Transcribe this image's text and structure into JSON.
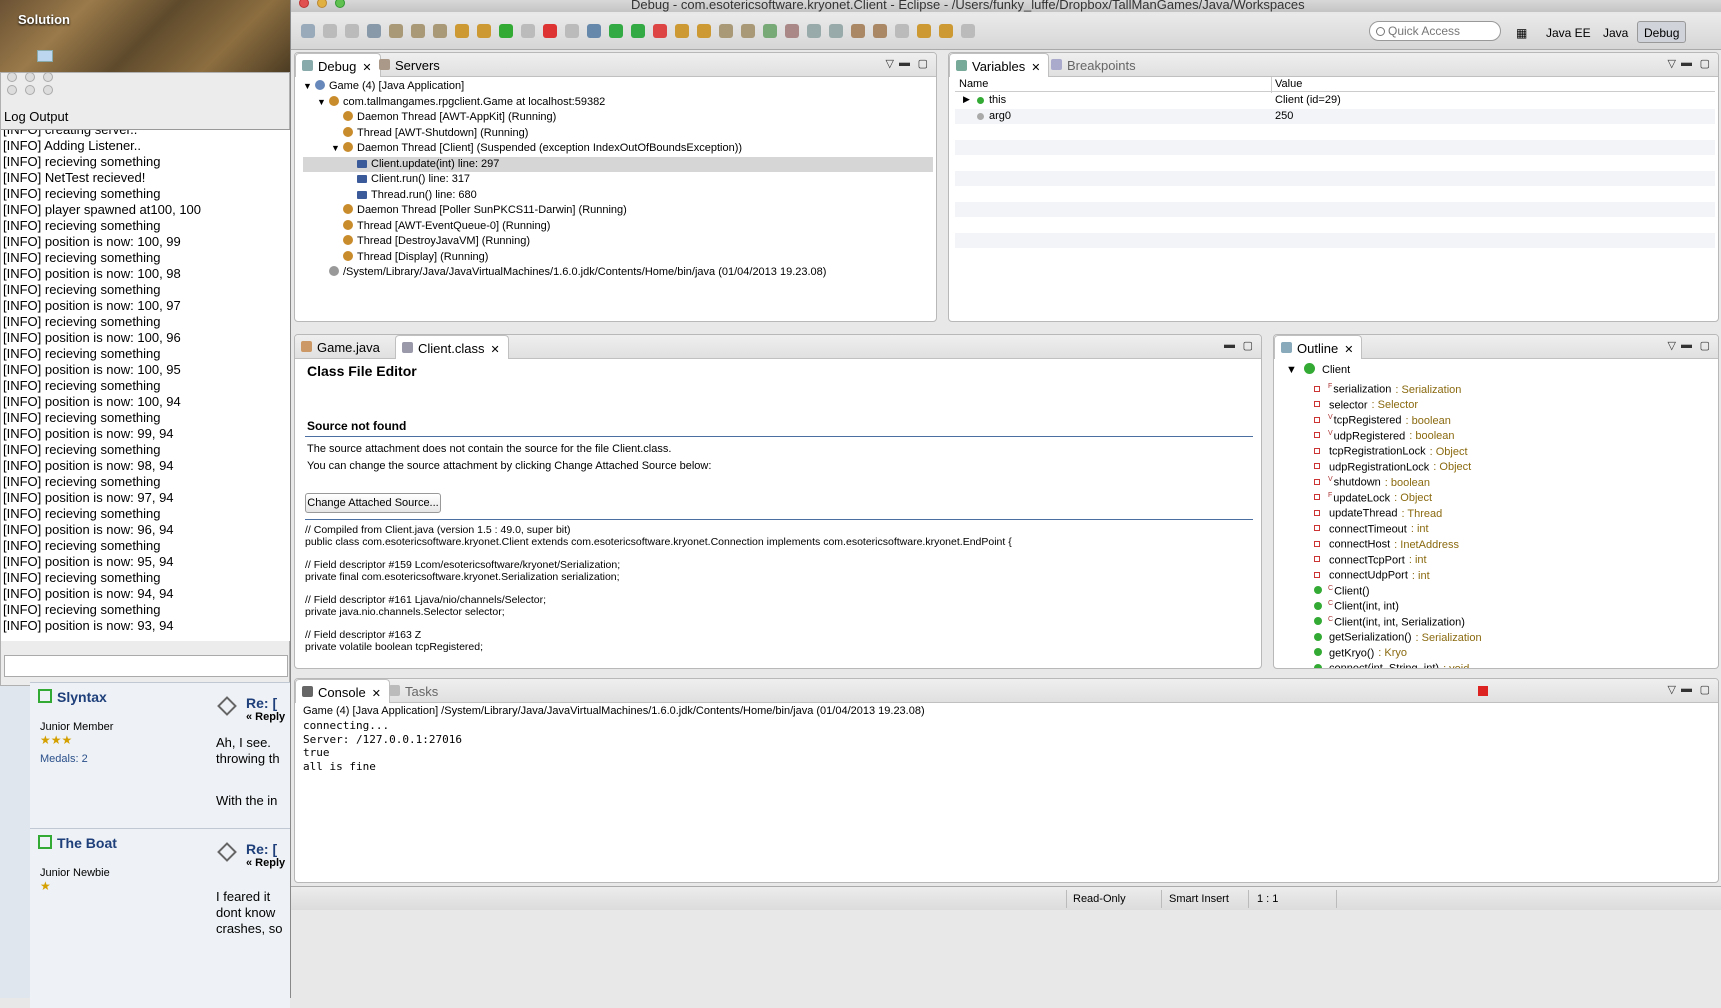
{
  "desktop": {
    "folder_label": "Solution"
  },
  "log_window": {
    "title": "Log Output",
    "lines": [
      "[INFO] creating server..",
      "[INFO] Adding Listener..",
      "[INFO] recieving something",
      "[INFO] NetTest recieved!",
      "[INFO] recieving something",
      "[INFO] player spawned at100, 100",
      "[INFO] recieving something",
      "[INFO] position is now: 100, 99",
      "[INFO] recieving something",
      "[INFO] position is now: 100, 98",
      "[INFO] recieving something",
      "[INFO] position is now: 100, 97",
      "[INFO] recieving something",
      "[INFO] position is now: 100, 96",
      "[INFO] recieving something",
      "[INFO] position is now: 100, 95",
      "[INFO] recieving something",
      "[INFO] position is now: 100, 94",
      "[INFO] recieving something",
      "[INFO] position is now: 99, 94",
      "[INFO] recieving something",
      "[INFO] position is now: 98, 94",
      "[INFO] recieving something",
      "[INFO] position is now: 97, 94",
      "[INFO] recieving something",
      "[INFO] position is now: 96, 94",
      "[INFO] recieving something",
      "[INFO] position is now: 95, 94",
      "[INFO] recieving something",
      "[INFO] position is now: 94, 94",
      "[INFO] recieving something",
      "[INFO] position is now: 93, 94"
    ]
  },
  "forum": {
    "posts": [
      {
        "author": "Slyntax",
        "rank": "Junior Member",
        "stars": "★★★",
        "medals": "Medals: 2",
        "re": "Re: [",
        "reply": "« Reply",
        "text": [
          "Ah, I see.",
          "throwing th",
          "",
          "With the in"
        ]
      },
      {
        "author": "The Boat",
        "rank": "Junior Newbie",
        "stars": "★",
        "medals": "",
        "re": "Re: [",
        "reply": "« Reply",
        "text": [
          "I feared it",
          "dont know",
          "crashes, so"
        ]
      }
    ]
  },
  "eclipse": {
    "title": "Debug - com.esotericsoftware.kryonet.Client - Eclipse - /Users/funky_luffe/Dropbox/TallManGames/Java/Workspaces",
    "quick_access_placeholder": "Quick Access",
    "perspectives": [
      "Java EE",
      "Java",
      "Debug"
    ],
    "debug_panel": {
      "tabs": [
        "Debug",
        "Servers"
      ],
      "tree": [
        {
          "text": "Game (4) [Java Application]",
          "level": 0,
          "icon": "java-app-icon",
          "exp": "▼"
        },
        {
          "text": "com.tallmangames.rpgclient.Game at localhost:59382",
          "level": 1,
          "icon": "process-icon",
          "exp": "▼"
        },
        {
          "text": "Daemon Thread [AWT-AppKit] (Running)",
          "level": 2,
          "icon": "thread-running-icon",
          "exp": ""
        },
        {
          "text": "Thread [AWT-Shutdown] (Running)",
          "level": 2,
          "icon": "thread-running-icon",
          "exp": ""
        },
        {
          "text": "Daemon Thread [Client] (Suspended (exception IndexOutOfBoundsException))",
          "level": 2,
          "icon": "thread-suspended-icon",
          "exp": "▼"
        },
        {
          "text": "Client.update(int) line: 297",
          "level": 3,
          "icon": "stack-frame-icon",
          "exp": ""
        },
        {
          "text": "Client.run() line: 317",
          "level": 3,
          "icon": "stack-frame-icon",
          "exp": ""
        },
        {
          "text": "Thread.run() line: 680",
          "level": 3,
          "icon": "stack-frame-icon",
          "exp": ""
        },
        {
          "text": "Daemon Thread [Poller SunPKCS11-Darwin] (Running)",
          "level": 2,
          "icon": "thread-running-icon",
          "exp": ""
        },
        {
          "text": "Thread [AWT-EventQueue-0] (Running)",
          "level": 2,
          "icon": "thread-running-icon",
          "exp": ""
        },
        {
          "text": "Thread [DestroyJavaVM] (Running)",
          "level": 2,
          "icon": "thread-running-icon",
          "exp": ""
        },
        {
          "text": "Thread [Display] (Running)",
          "level": 2,
          "icon": "thread-running-icon",
          "exp": ""
        },
        {
          "text": "/System/Library/Java/JavaVirtualMachines/1.6.0.jdk/Contents/Home/bin/java (01/04/2013 19.23.08)",
          "level": 1,
          "icon": "vm-icon",
          "exp": ""
        }
      ]
    },
    "variables_panel": {
      "tabs": [
        "Variables",
        "Breakpoints"
      ],
      "columns": [
        "Name",
        "Value"
      ],
      "rows": [
        {
          "name": "this",
          "value": "Client  (id=29)"
        },
        {
          "name": "arg0",
          "value": "250"
        }
      ]
    },
    "editor": {
      "tabs": [
        "Game.java",
        "Client.class"
      ],
      "heading": "Class File Editor",
      "subheading": "Source not found",
      "para1": "The source attachment does not contain the source for the file Client.class.",
      "para2": "You can change the source attachment by clicking Change Attached Source below:",
      "button": "Change Attached Source...",
      "code": [
        "// Compiled from Client.java (version 1.5 : 49.0, super bit)",
        "public class com.esotericsoftware.kryonet.Client extends com.esotericsoftware.kryonet.Connection implements com.esotericsoftware.kryonet.EndPoint {",
        "",
        "  // Field descriptor #159 Lcom/esotericsoftware/kryonet/Serialization;",
        "  private final com.esotericsoftware.kryonet.Serialization serialization;",
        "",
        "  // Field descriptor #161 Ljava/nio/channels/Selector;",
        "  private java.nio.channels.Selector selector;",
        "",
        "  // Field descriptor #163 Z",
        "  private volatile boolean tcpRegistered;"
      ]
    },
    "outline": {
      "tab": "Outline",
      "root": "Client",
      "items": [
        {
          "sup": "F",
          "name": "serialization",
          "type": ": Serialization",
          "kind": "field"
        },
        {
          "sup": "",
          "name": "selector",
          "type": ": Selector",
          "kind": "field"
        },
        {
          "sup": "V",
          "name": "tcpRegistered",
          "type": ": boolean",
          "kind": "field"
        },
        {
          "sup": "V",
          "name": "udpRegistered",
          "type": ": boolean",
          "kind": "field"
        },
        {
          "sup": "",
          "name": "tcpRegistrationLock",
          "type": ": Object",
          "kind": "field"
        },
        {
          "sup": "",
          "name": "udpRegistrationLock",
          "type": ": Object",
          "kind": "field"
        },
        {
          "sup": "V",
          "name": "shutdown",
          "type": ": boolean",
          "kind": "field"
        },
        {
          "sup": "F",
          "name": "updateLock",
          "type": ": Object",
          "kind": "field"
        },
        {
          "sup": "",
          "name": "updateThread",
          "type": ": Thread",
          "kind": "field"
        },
        {
          "sup": "",
          "name": "connectTimeout",
          "type": ": int",
          "kind": "field"
        },
        {
          "sup": "",
          "name": "connectHost",
          "type": ": InetAddress",
          "kind": "field"
        },
        {
          "sup": "",
          "name": "connectTcpPort",
          "type": ": int",
          "kind": "field"
        },
        {
          "sup": "",
          "name": "connectUdpPort",
          "type": ": int",
          "kind": "field"
        },
        {
          "sup": "C",
          "name": "Client()",
          "type": "",
          "kind": "method"
        },
        {
          "sup": "C",
          "name": "Client(int, int)",
          "type": "",
          "kind": "method"
        },
        {
          "sup": "C",
          "name": "Client(int, int, Serialization)",
          "type": "",
          "kind": "method"
        },
        {
          "sup": "",
          "name": "getSerialization()",
          "type": ": Serialization",
          "kind": "method"
        },
        {
          "sup": "",
          "name": "getKryo()",
          "type": ": Kryo",
          "kind": "method"
        },
        {
          "sup": "",
          "name": "connect(int, String, int)",
          "type": ": void",
          "kind": "method"
        }
      ]
    },
    "console": {
      "tabs": [
        "Console",
        "Tasks"
      ],
      "header": "Game (4) [Java Application] /System/Library/Java/JavaVirtualMachines/1.6.0.jdk/Contents/Home/bin/java (01/04/2013 19.23.08)",
      "lines": [
        "connecting...",
        "Server: /127.0.0.1:27016",
        "true",
        "all is fine"
      ]
    },
    "status": {
      "mode": "Read-Only",
      "insert": "Smart Insert",
      "position": "1 : 1"
    }
  }
}
